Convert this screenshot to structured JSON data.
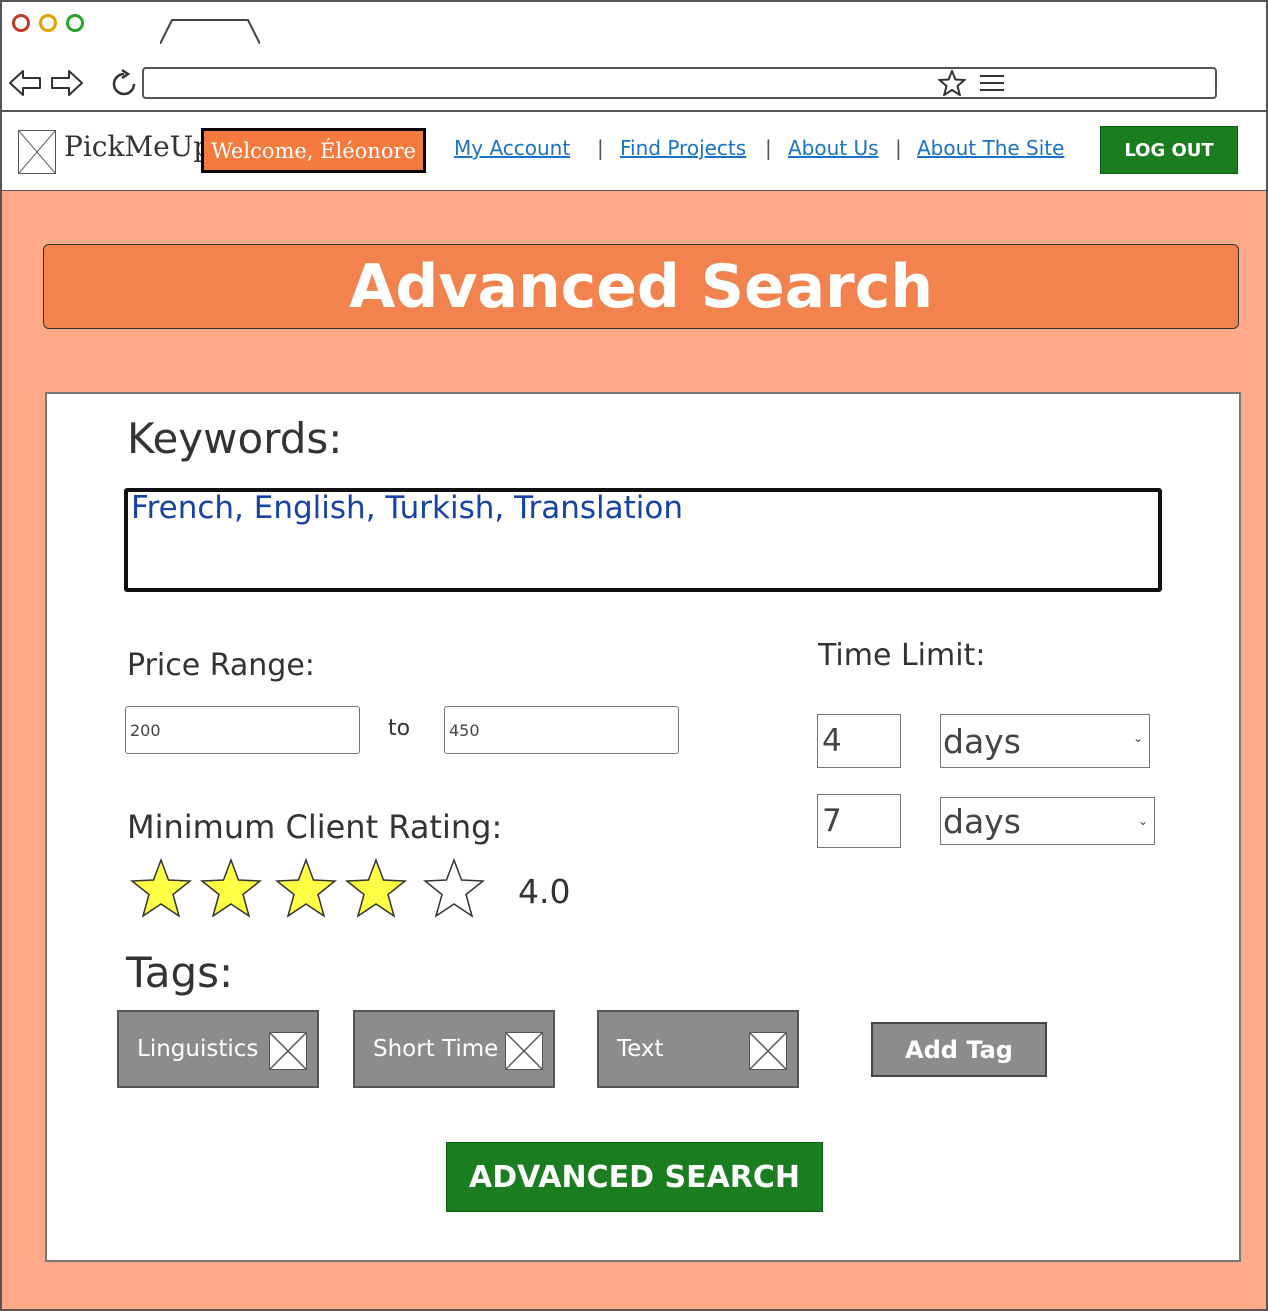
{
  "browser": {
    "tab_label": "",
    "address": ""
  },
  "header": {
    "brand": "PickMeUp",
    "welcome": "Welcome, Éléonore",
    "nav": [
      {
        "label": "My Account"
      },
      {
        "label": "Find Projects"
      },
      {
        "label": "About Us"
      },
      {
        "label": "About The Site"
      }
    ],
    "separator": "|",
    "logout": "LOG OUT"
  },
  "banner": {
    "title": "Advanced Search"
  },
  "form": {
    "keywords_label": "Keywords:",
    "keywords_value": "French, English, Turkish, Translation",
    "price_label": "Price Range:",
    "price_min": "200",
    "price_to": "to",
    "price_max": "450",
    "time_label": "Time Limit:",
    "time_rows": [
      {
        "value": "4",
        "unit": "days"
      },
      {
        "value": "7",
        "unit": "days"
      }
    ],
    "rating_label": "Minimum Client Rating:",
    "rating_value": "4.0",
    "rating_stars": 4,
    "rating_max": 5,
    "tags_label": "Tags:",
    "tags": [
      {
        "label": "Linguistics"
      },
      {
        "label": "Short Time"
      },
      {
        "label": "Text"
      }
    ],
    "add_tag": "Add Tag",
    "submit": "ADVANCED SEARCH"
  },
  "colors": {
    "page_bg": "#fea988",
    "banner": "#f2824e",
    "welcome_bg": "#f47a3e",
    "primary_button": "#1a7d1f",
    "tag_bg": "#8c8c8c",
    "link": "#1a73c8",
    "star_fill": "#ffff44"
  }
}
